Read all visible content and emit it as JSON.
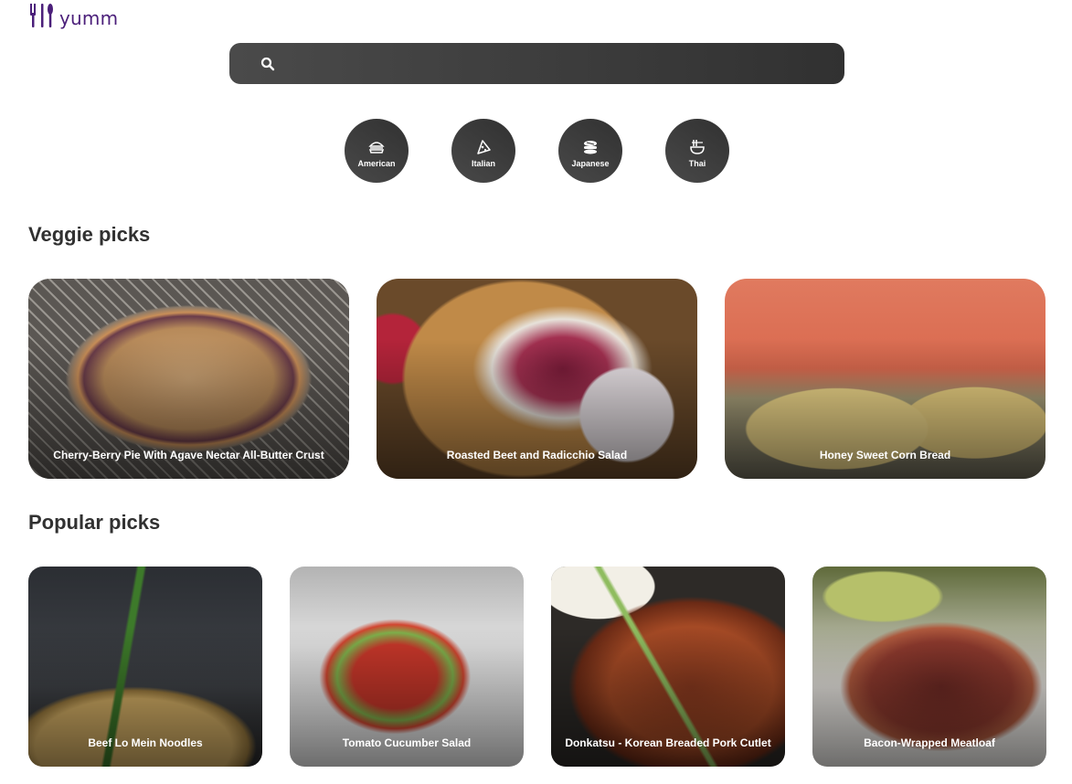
{
  "header": {
    "logo_text": "yumm",
    "logo_icon": "fork-knife-icon"
  },
  "search": {
    "value": "",
    "placeholder": "",
    "icon": "search-icon"
  },
  "cuisines": [
    {
      "label": "American",
      "icon": "burger-icon"
    },
    {
      "label": "Italian",
      "icon": "pizza-icon"
    },
    {
      "label": "Japanese",
      "icon": "sushi-icon"
    },
    {
      "label": "Thai",
      "icon": "noodle-bowl-icon"
    }
  ],
  "veggie": {
    "title": "Veggie picks",
    "items": [
      {
        "title": "Cherry-Berry Pie With Agave Nectar All-Butter Crust"
      },
      {
        "title": "Roasted Beet and Radicchio Salad"
      },
      {
        "title": "Honey Sweet Corn Bread"
      }
    ]
  },
  "popular": {
    "title": "Popular picks",
    "items": [
      {
        "title": "Beef Lo Mein Noodles"
      },
      {
        "title": "Tomato Cucumber Salad"
      },
      {
        "title": "Donkatsu - Korean Breaded Pork Cutlet"
      },
      {
        "title": "Bacon-Wrapped Meatloaf"
      }
    ]
  },
  "colors": {
    "brand": "#4b1f7a",
    "dark": "#313131",
    "card_text": "#ffffff"
  }
}
